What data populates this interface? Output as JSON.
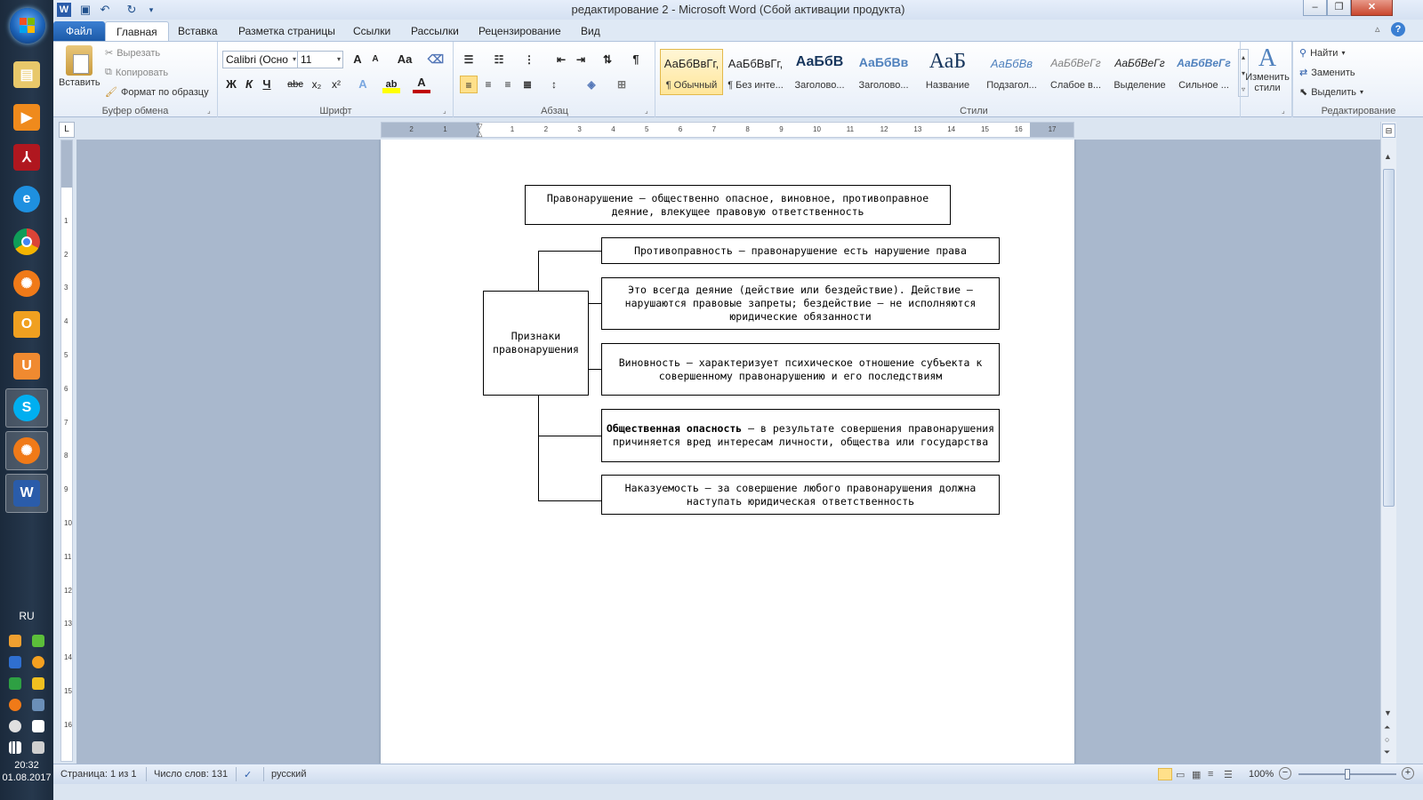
{
  "window": {
    "title": "редактирование 2  -  Microsoft Word (Сбой активации продукта)"
  },
  "tabs": [
    "Файл",
    "Главная",
    "Вставка",
    "Разметка страницы",
    "Ссылки",
    "Рассылки",
    "Рецензирование",
    "Вид"
  ],
  "ribbon": {
    "clipboard": {
      "paste": "Вставить",
      "cut": "Вырезать",
      "copy": "Копировать",
      "format_painter": "Формат по образцу",
      "label": "Буфер обмена"
    },
    "font": {
      "name": "Calibri (Осно",
      "size": "11",
      "bold": "Ж",
      "italic": "К",
      "underline": "Ч",
      "strike": "abc",
      "subscript": "x₂",
      "superscript": "x²",
      "grow": "A",
      "shrink": "A",
      "case": "Aa",
      "font_color": "A",
      "label": "Шрифт"
    },
    "paragraph": {
      "label": "Абзац",
      "pilcrow": "¶"
    },
    "styles": {
      "label": "Стили",
      "items": [
        {
          "sample": "АаБбВвГг,",
          "name": "¶ Обычный"
        },
        {
          "sample": "АаБбВвГг,",
          "name": "¶ Без инте..."
        },
        {
          "sample": "АаБбВ",
          "name": "Заголово..."
        },
        {
          "sample": "АаБбВв",
          "name": "Заголово..."
        },
        {
          "sample": "АаБ",
          "name": "Название"
        },
        {
          "sample": "АаБбВв",
          "name": "Подзагол..."
        },
        {
          "sample": "АаБбВеГг",
          "name": "Слабое в..."
        },
        {
          "sample": "АаБбВеГг",
          "name": "Выделение"
        },
        {
          "sample": "АаБбВеГг",
          "name": "Сильное ..."
        }
      ],
      "change_styles": "Изменить стили"
    },
    "editing": {
      "find": "Найти",
      "replace": "Заменить",
      "select": "Выделить",
      "label": "Редактирование"
    }
  },
  "document": {
    "definition": "Правонарушение – общественно опасное, виновное, противоправное деяние, влекущее правовую ответственность",
    "center_label": "Признаки правонарушения",
    "features": [
      {
        "bold": "",
        "text": "Противоправность – правонарушение есть нарушение права"
      },
      {
        "bold": "",
        "text": "Это всегда деяние (действие или бездействие). Действие – нарушаются правовые запреты; бездействие – не исполняются юридические обязанности"
      },
      {
        "bold": "",
        "text": "Виновность – характеризует психическое отношение субъекта к совершенному правонарушению и его последствиям"
      },
      {
        "bold": "Общественная опасность",
        "text": " – в результате совершения правонарушения причиняется вред интересам личности, общества или государства"
      },
      {
        "bold": "",
        "text": "Наказуемость – за совершение любого правонарушения должна наступать юридическая ответственность"
      }
    ]
  },
  "statusbar": {
    "page": "Страница: 1 из 1",
    "words": "Число слов: 131",
    "language": "русский",
    "zoom": "100%"
  },
  "taskbar": {
    "language": "RU",
    "time": "20:32",
    "date": "01.08.2017"
  },
  "colors": {
    "file_tab": "#1c5aa8",
    "taskbar": "#1b2a3c",
    "selected_style": "#ffe69a"
  }
}
